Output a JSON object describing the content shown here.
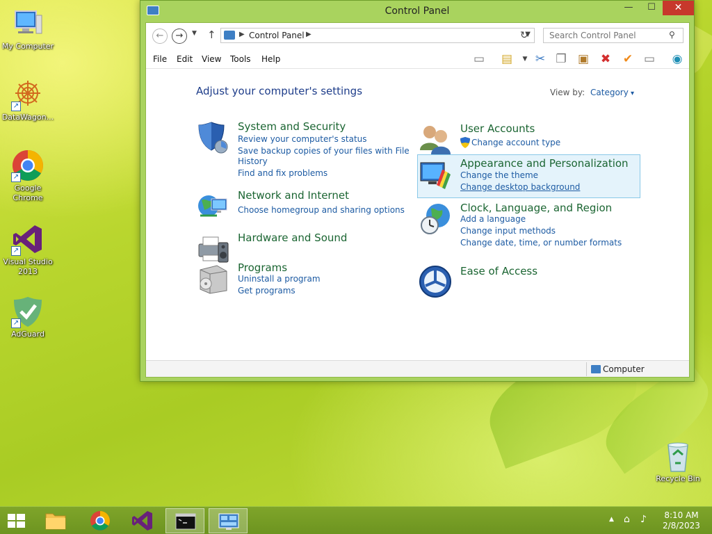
{
  "desktop": {
    "icons": [
      {
        "label": "My Computer"
      },
      {
        "label": "DataWagon..."
      },
      {
        "label": "Google Chrome"
      },
      {
        "label": "Visual Studio 2013"
      },
      {
        "label": "AdGuard"
      },
      {
        "label": "Recycle Bin"
      }
    ]
  },
  "window": {
    "title": "Control Panel",
    "minimize": "—",
    "maximize": "☐",
    "close": "✕"
  },
  "address": {
    "crumb": "Control Panel",
    "search_placeholder": "Search Control Panel"
  },
  "menu": [
    "File",
    "Edit",
    "View",
    "Tools",
    "Help"
  ],
  "content": {
    "heading": "Adjust your computer's settings",
    "view_by_label": "View by:",
    "view_by_value": "Category"
  },
  "categories": {
    "system_security": {
      "title": "System and Security",
      "links": [
        "Review your computer's status",
        "Save backup copies of your files with File",
        "History",
        "Find and fix problems"
      ]
    },
    "network": {
      "title": "Network and Internet",
      "links": [
        "Choose homegroup and sharing options"
      ]
    },
    "hardware": {
      "title": "Hardware and Sound"
    },
    "programs": {
      "title": "Programs",
      "links": [
        "Uninstall a program",
        "Get programs"
      ]
    },
    "user_accounts": {
      "title": "User Accounts",
      "links": [
        "Change account type"
      ]
    },
    "appearance": {
      "title": "Appearance and Personalization",
      "links": [
        "Change the theme",
        "Change desktop background"
      ]
    },
    "clock": {
      "title": "Clock, Language, and Region",
      "links": [
        "Add a language",
        "Change input methods",
        "Change date, time, or number formats"
      ]
    },
    "ease": {
      "title": "Ease of Access"
    }
  },
  "statusbar": {
    "location": "Computer"
  },
  "taskbar": {
    "time": "8:10 AM",
    "date": "2/8/2023"
  }
}
